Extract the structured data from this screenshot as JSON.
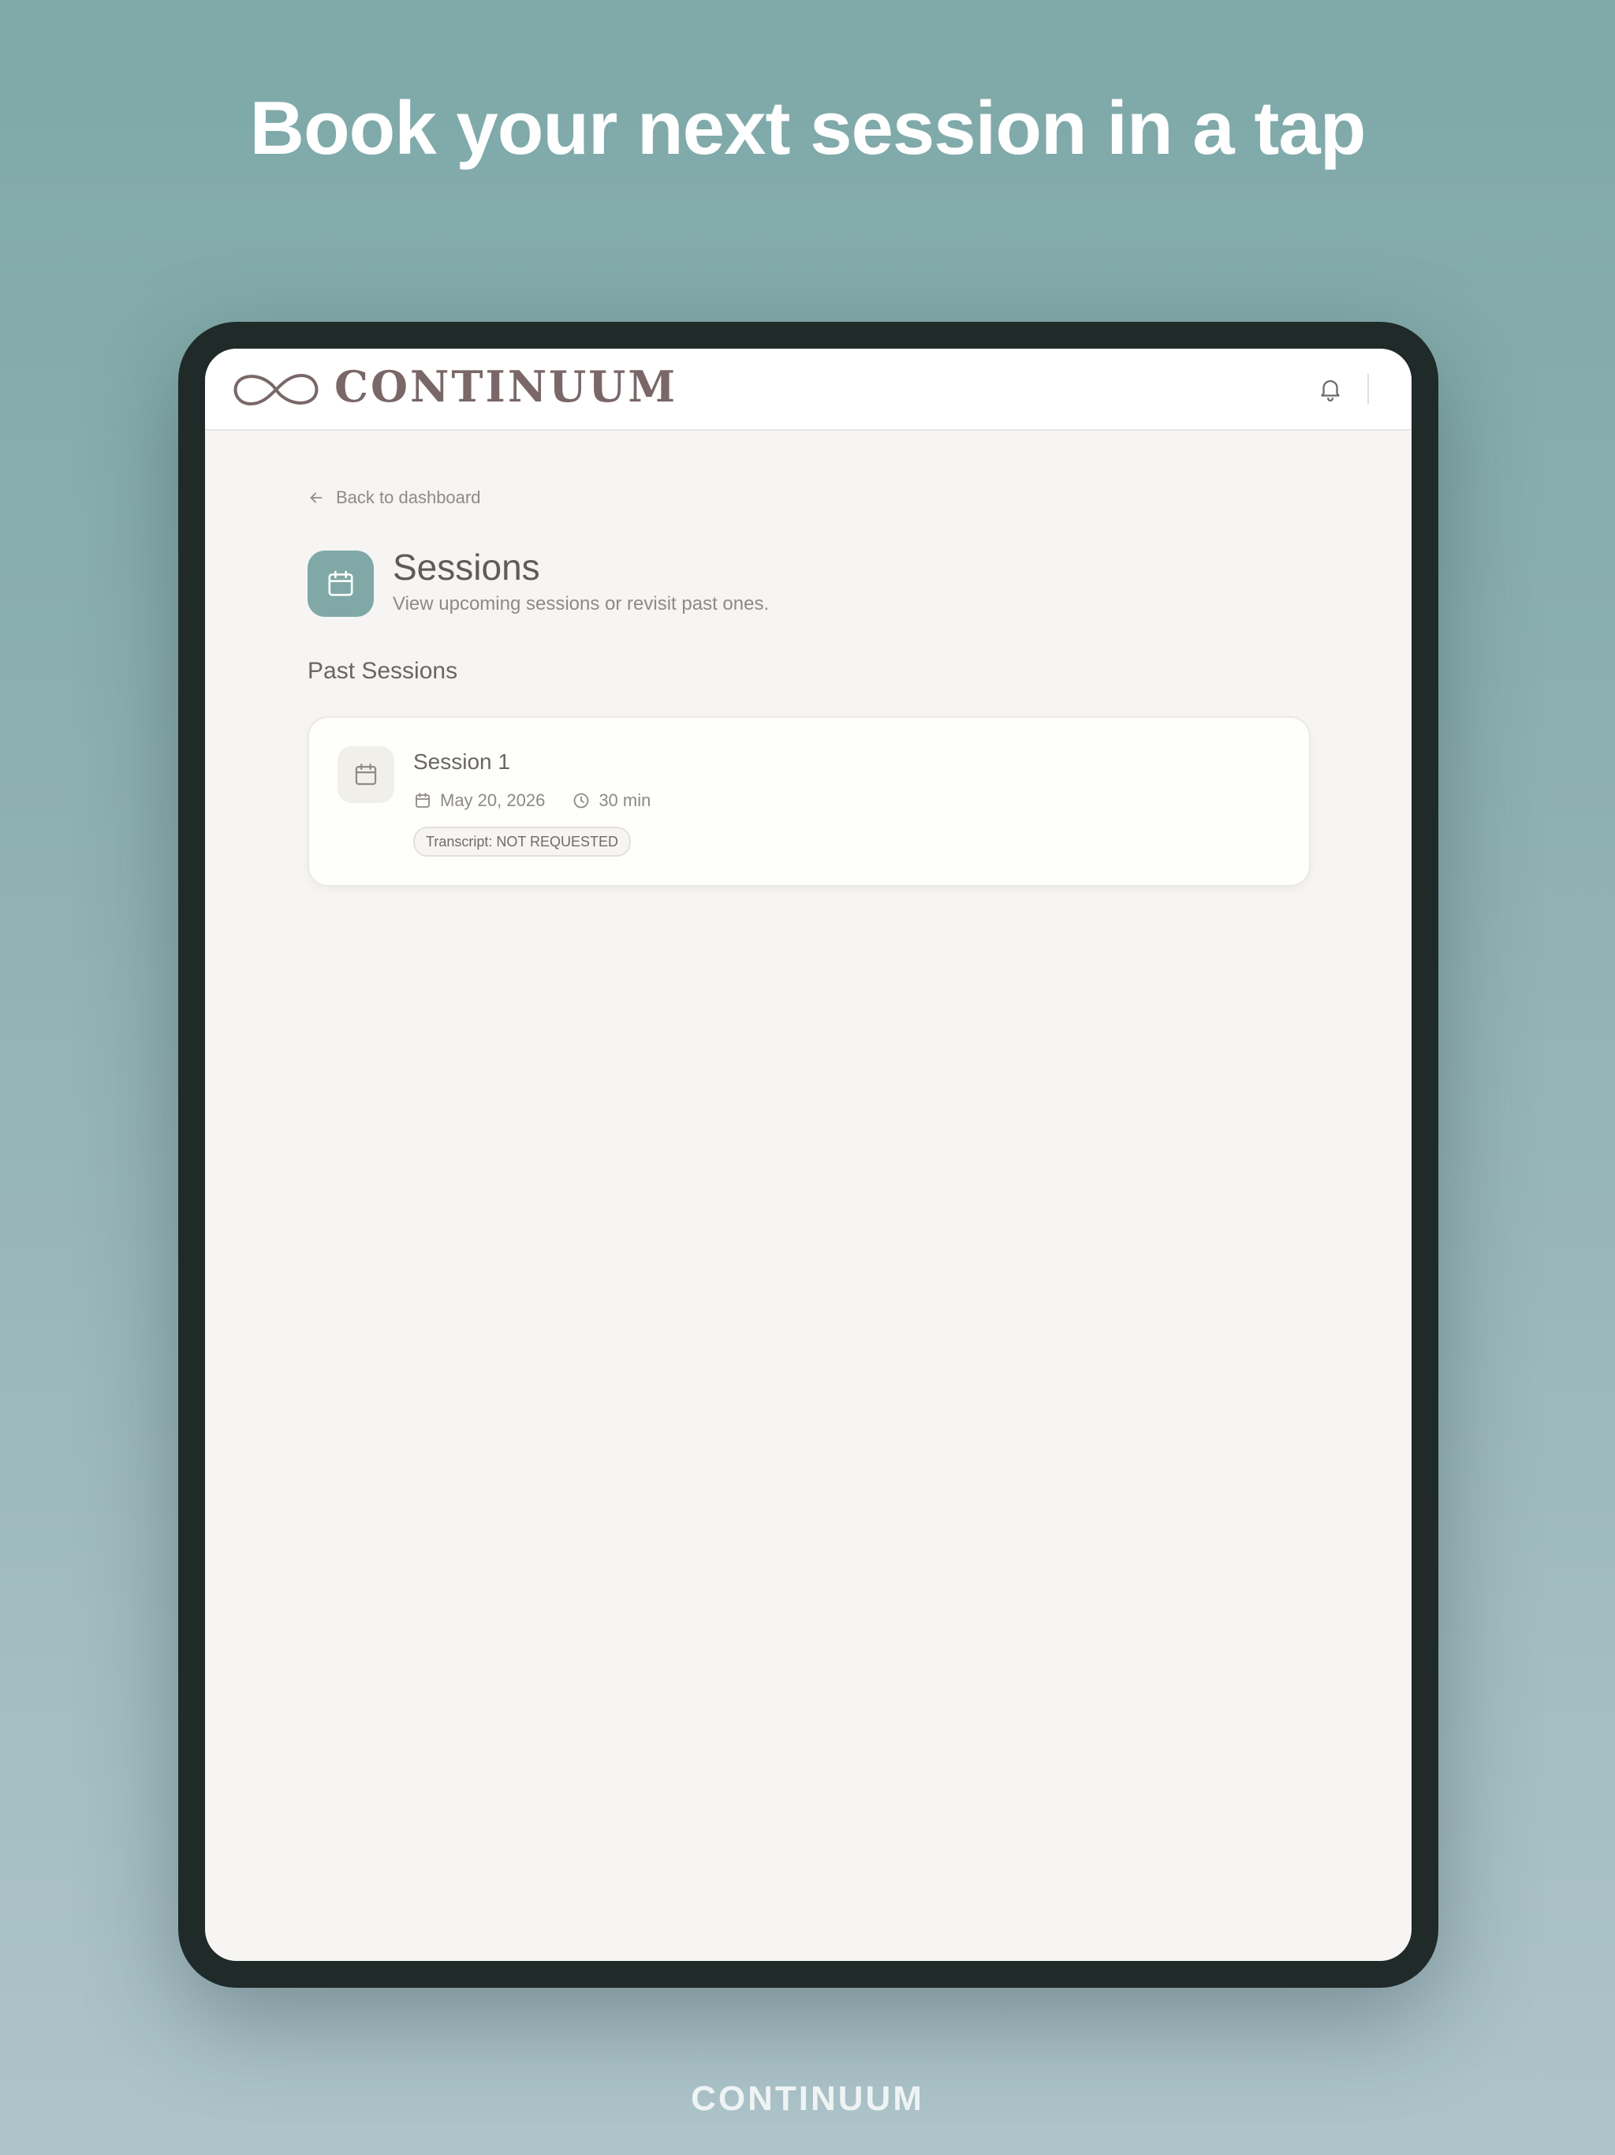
{
  "promo": {
    "headline": "Book your next session in a tap",
    "footer_brand": "CONTINUUM"
  },
  "app": {
    "brand_name": "CONTINUUM",
    "logo_icon": "infinity-icon",
    "notification_icon": "bell-icon"
  },
  "page": {
    "back_label": "Back to dashboard",
    "back_icon": "arrow-left-icon",
    "title": "Sessions",
    "subtitle": "View upcoming sessions or revisit past ones.",
    "title_icon": "calendar-icon"
  },
  "past_sessions": {
    "heading": "Past Sessions",
    "items": [
      {
        "title": "Session 1",
        "date": "May 20, 2026",
        "duration": "30 min",
        "badge": "Transcript: NOT REQUESTED",
        "icon": "calendar-icon"
      }
    ]
  },
  "colors": {
    "background_top": "#7ea9a8",
    "background_bottom": "#adc4ca",
    "accent": "#7fa8a6",
    "brand_text": "#7a6768",
    "device_frame": "#1f2a29"
  }
}
